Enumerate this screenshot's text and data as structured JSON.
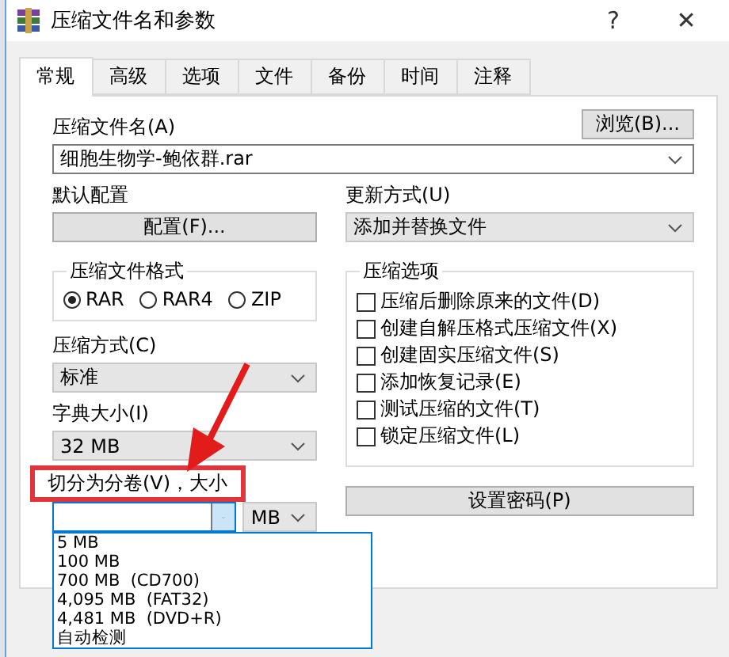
{
  "window": {
    "title": "压缩文件名和参数",
    "help": "?",
    "close": "✕"
  },
  "tabs": [
    {
      "label": "常规",
      "selected": true
    },
    {
      "label": "高级",
      "selected": false
    },
    {
      "label": "选项",
      "selected": false
    },
    {
      "label": "文件",
      "selected": false
    },
    {
      "label": "备份",
      "selected": false
    },
    {
      "label": "时间",
      "selected": false
    },
    {
      "label": "注释",
      "selected": false
    }
  ],
  "archive_name": {
    "label": "压缩文件名(A)",
    "value": "细胞生物学-鲍依群.rar",
    "browse": "浏览(B)..."
  },
  "profile": {
    "label": "默认配置",
    "button": "配置(F)..."
  },
  "update_mode": {
    "label": "更新方式(U)",
    "value": "添加并替换文件"
  },
  "format": {
    "label": "压缩文件格式",
    "options": [
      {
        "label": "RAR",
        "selected": true
      },
      {
        "label": "RAR4",
        "selected": false
      },
      {
        "label": "ZIP",
        "selected": false
      }
    ]
  },
  "method": {
    "label": "压缩方式(C)",
    "value": "标准"
  },
  "dictionary": {
    "label": "字典大小(I)",
    "value": "32 MB"
  },
  "options": {
    "label": "压缩选项",
    "items": [
      {
        "label": "压缩后删除原来的文件(D)",
        "checked": false
      },
      {
        "label": "创建自解压格式压缩文件(X)",
        "checked": false
      },
      {
        "label": "创建固实压缩文件(S)",
        "checked": false
      },
      {
        "label": "添加恢复记录(E)",
        "checked": false
      },
      {
        "label": "测试压缩的文件(T)",
        "checked": false
      },
      {
        "label": "锁定压缩文件(L)",
        "checked": false
      }
    ]
  },
  "split": {
    "label": "切分为分卷(V)，大小",
    "unit": "MB",
    "list": [
      "5 MB",
      "100 MB",
      "700 MB  (CD700)",
      "4,095 MB  (FAT32)",
      "4,481 MB  (DVD+R)",
      "自动检测"
    ]
  },
  "password": {
    "button": "设置密码(P)"
  }
}
